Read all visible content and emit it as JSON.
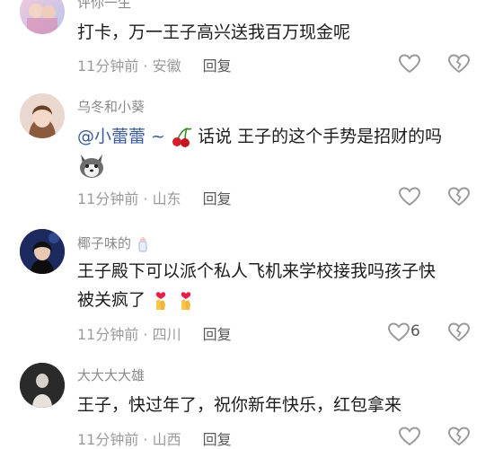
{
  "comments": [
    {
      "username": "评你一生",
      "text": "打卡，万一王子高兴送我百万现金呢",
      "time": "11分钟前",
      "location": "安徽",
      "reply_label": "回复"
    },
    {
      "username": "乌冬和小葵",
      "mention": "@小蕾蕾 ~",
      "text": "话说 王子的这个手势是招财的吗",
      "emoji_inline": "cherries",
      "sticker": "husky-dog-sticker",
      "time": "11分钟前",
      "location": "山东",
      "reply_label": "回复"
    },
    {
      "username": "椰子味的",
      "username_emoji": "baby-bottle",
      "text_line1": "王子殿下可以派个私人飞机来学校接我吗孩子快",
      "text_line2": "被关疯了",
      "emoji_inline": "heart-hands",
      "time": "11分钟前",
      "location": "四川",
      "reply_label": "回复",
      "like_count": "6"
    },
    {
      "username": "大大大大雄",
      "text": "王子，快过年了，祝你新年快乐，红包拿来",
      "time": "11分钟前",
      "location": "山西",
      "reply_label": "回复"
    }
  ],
  "colors": {
    "text": "#1c1c1c",
    "meta": "#9a9a9a",
    "username": "#8a8a8a",
    "mention": "#3b5b9a"
  }
}
